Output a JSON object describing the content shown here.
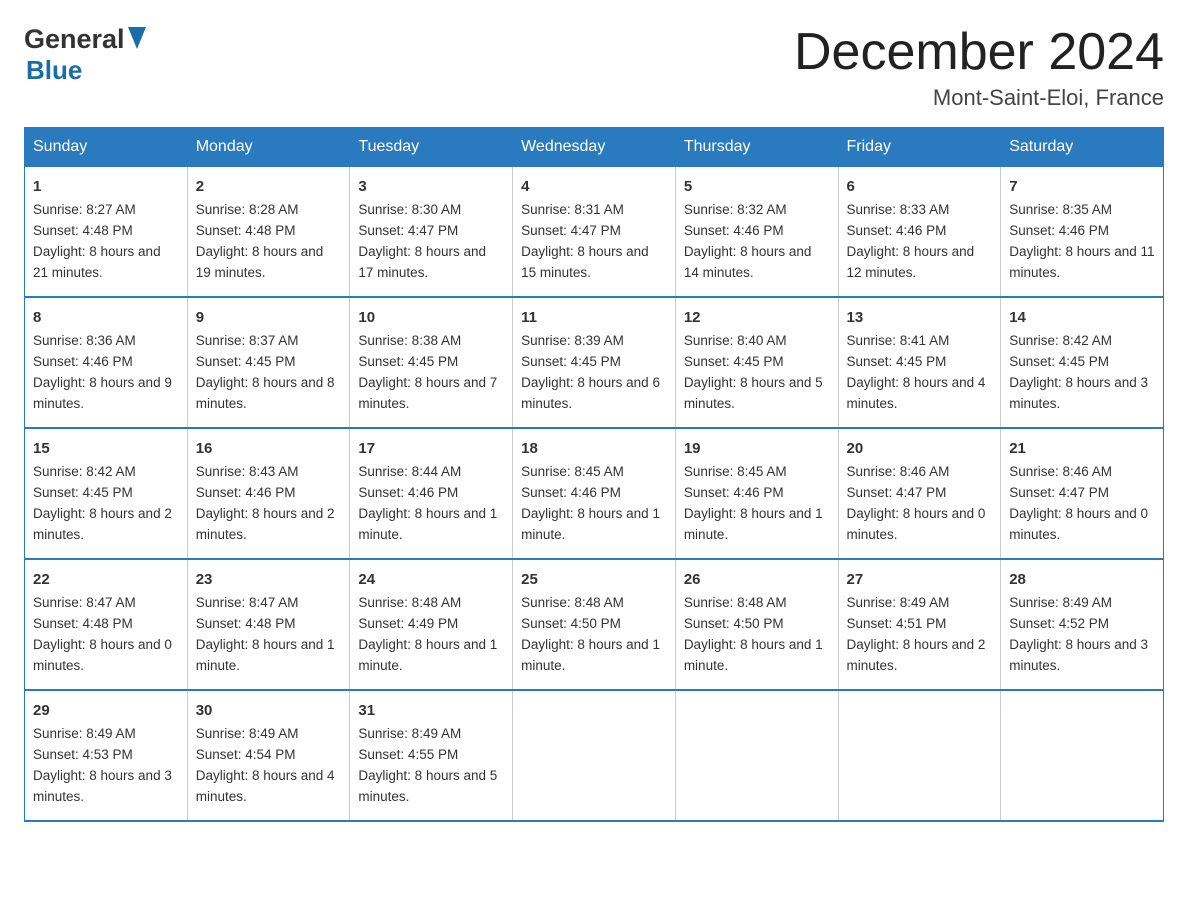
{
  "logo": {
    "general": "General",
    "blue": "Blue"
  },
  "title": "December 2024",
  "location": "Mont-Saint-Eloi, France",
  "days_of_week": [
    "Sunday",
    "Monday",
    "Tuesday",
    "Wednesday",
    "Thursday",
    "Friday",
    "Saturday"
  ],
  "weeks": [
    [
      {
        "day": "1",
        "sunrise": "8:27 AM",
        "sunset": "4:48 PM",
        "daylight": "8 hours and 21 minutes."
      },
      {
        "day": "2",
        "sunrise": "8:28 AM",
        "sunset": "4:48 PM",
        "daylight": "8 hours and 19 minutes."
      },
      {
        "day": "3",
        "sunrise": "8:30 AM",
        "sunset": "4:47 PM",
        "daylight": "8 hours and 17 minutes."
      },
      {
        "day": "4",
        "sunrise": "8:31 AM",
        "sunset": "4:47 PM",
        "daylight": "8 hours and 15 minutes."
      },
      {
        "day": "5",
        "sunrise": "8:32 AM",
        "sunset": "4:46 PM",
        "daylight": "8 hours and 14 minutes."
      },
      {
        "day": "6",
        "sunrise": "8:33 AM",
        "sunset": "4:46 PM",
        "daylight": "8 hours and 12 minutes."
      },
      {
        "day": "7",
        "sunrise": "8:35 AM",
        "sunset": "4:46 PM",
        "daylight": "8 hours and 11 minutes."
      }
    ],
    [
      {
        "day": "8",
        "sunrise": "8:36 AM",
        "sunset": "4:46 PM",
        "daylight": "8 hours and 9 minutes."
      },
      {
        "day": "9",
        "sunrise": "8:37 AM",
        "sunset": "4:45 PM",
        "daylight": "8 hours and 8 minutes."
      },
      {
        "day": "10",
        "sunrise": "8:38 AM",
        "sunset": "4:45 PM",
        "daylight": "8 hours and 7 minutes."
      },
      {
        "day": "11",
        "sunrise": "8:39 AM",
        "sunset": "4:45 PM",
        "daylight": "8 hours and 6 minutes."
      },
      {
        "day": "12",
        "sunrise": "8:40 AM",
        "sunset": "4:45 PM",
        "daylight": "8 hours and 5 minutes."
      },
      {
        "day": "13",
        "sunrise": "8:41 AM",
        "sunset": "4:45 PM",
        "daylight": "8 hours and 4 minutes."
      },
      {
        "day": "14",
        "sunrise": "8:42 AM",
        "sunset": "4:45 PM",
        "daylight": "8 hours and 3 minutes."
      }
    ],
    [
      {
        "day": "15",
        "sunrise": "8:42 AM",
        "sunset": "4:45 PM",
        "daylight": "8 hours and 2 minutes."
      },
      {
        "day": "16",
        "sunrise": "8:43 AM",
        "sunset": "4:46 PM",
        "daylight": "8 hours and 2 minutes."
      },
      {
        "day": "17",
        "sunrise": "8:44 AM",
        "sunset": "4:46 PM",
        "daylight": "8 hours and 1 minute."
      },
      {
        "day": "18",
        "sunrise": "8:45 AM",
        "sunset": "4:46 PM",
        "daylight": "8 hours and 1 minute."
      },
      {
        "day": "19",
        "sunrise": "8:45 AM",
        "sunset": "4:46 PM",
        "daylight": "8 hours and 1 minute."
      },
      {
        "day": "20",
        "sunrise": "8:46 AM",
        "sunset": "4:47 PM",
        "daylight": "8 hours and 0 minutes."
      },
      {
        "day": "21",
        "sunrise": "8:46 AM",
        "sunset": "4:47 PM",
        "daylight": "8 hours and 0 minutes."
      }
    ],
    [
      {
        "day": "22",
        "sunrise": "8:47 AM",
        "sunset": "4:48 PM",
        "daylight": "8 hours and 0 minutes."
      },
      {
        "day": "23",
        "sunrise": "8:47 AM",
        "sunset": "4:48 PM",
        "daylight": "8 hours and 1 minute."
      },
      {
        "day": "24",
        "sunrise": "8:48 AM",
        "sunset": "4:49 PM",
        "daylight": "8 hours and 1 minute."
      },
      {
        "day": "25",
        "sunrise": "8:48 AM",
        "sunset": "4:50 PM",
        "daylight": "8 hours and 1 minute."
      },
      {
        "day": "26",
        "sunrise": "8:48 AM",
        "sunset": "4:50 PM",
        "daylight": "8 hours and 1 minute."
      },
      {
        "day": "27",
        "sunrise": "8:49 AM",
        "sunset": "4:51 PM",
        "daylight": "8 hours and 2 minutes."
      },
      {
        "day": "28",
        "sunrise": "8:49 AM",
        "sunset": "4:52 PM",
        "daylight": "8 hours and 3 minutes."
      }
    ],
    [
      {
        "day": "29",
        "sunrise": "8:49 AM",
        "sunset": "4:53 PM",
        "daylight": "8 hours and 3 minutes."
      },
      {
        "day": "30",
        "sunrise": "8:49 AM",
        "sunset": "4:54 PM",
        "daylight": "8 hours and 4 minutes."
      },
      {
        "day": "31",
        "sunrise": "8:49 AM",
        "sunset": "4:55 PM",
        "daylight": "8 hours and 5 minutes."
      },
      {
        "day": "",
        "sunrise": "",
        "sunset": "",
        "daylight": ""
      },
      {
        "day": "",
        "sunrise": "",
        "sunset": "",
        "daylight": ""
      },
      {
        "day": "",
        "sunrise": "",
        "sunset": "",
        "daylight": ""
      },
      {
        "day": "",
        "sunrise": "",
        "sunset": "",
        "daylight": ""
      }
    ]
  ],
  "labels": {
    "sunrise": "Sunrise: ",
    "sunset": "Sunset: ",
    "daylight": "Daylight: "
  }
}
